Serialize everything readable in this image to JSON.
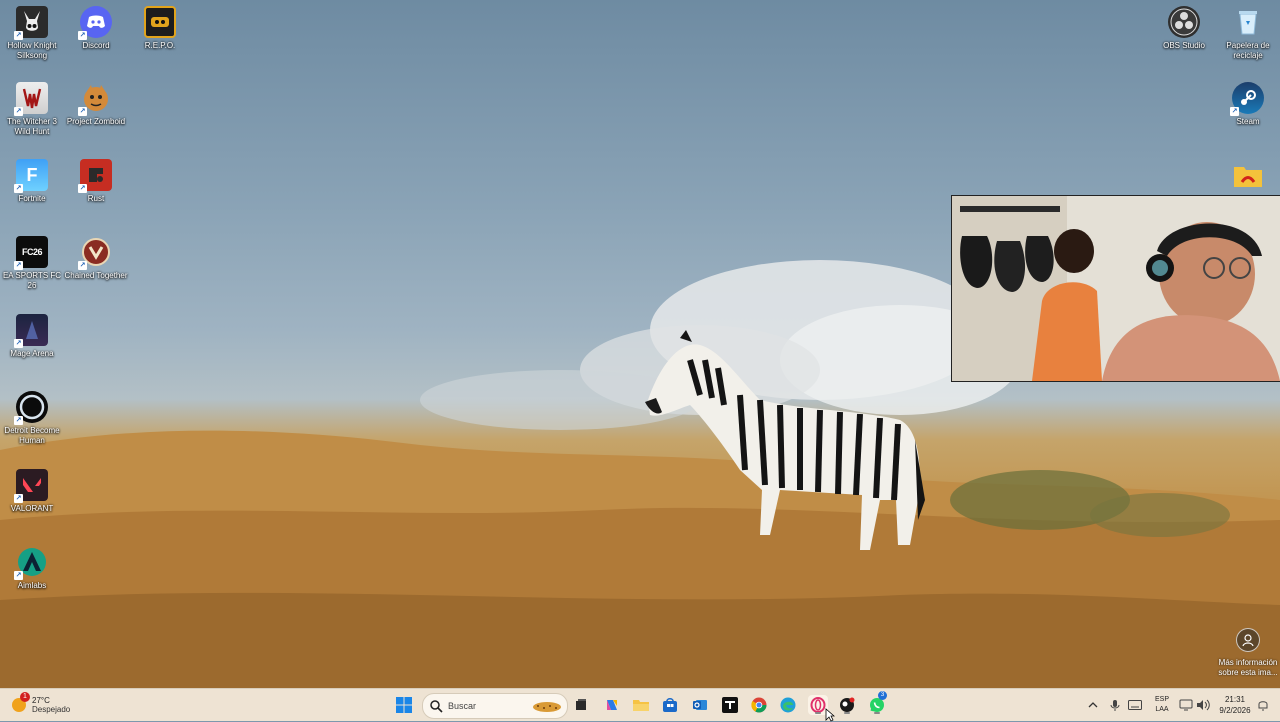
{
  "desktop": {
    "icons_left": [
      {
        "label": "Hollow Knight Silksong",
        "icon": "hollow-knight-icon"
      },
      {
        "label": "Discord",
        "icon": "discord-icon"
      },
      {
        "label": "R.E.P.O.",
        "icon": "repo-icon"
      },
      {
        "label": "The Witcher 3 Wild Hunt",
        "icon": "witcher-icon"
      },
      {
        "label": "Project Zomboid",
        "icon": "project-zomboid-icon"
      },
      {
        "label": "Fortnite",
        "icon": "fortnite-icon"
      },
      {
        "label": "Rust",
        "icon": "rust-icon"
      },
      {
        "label": "EA SPORTS FC 26",
        "icon": "ea-fc26-icon"
      },
      {
        "label": "Chained Together",
        "icon": "chained-together-icon"
      },
      {
        "label": "Mage Arena",
        "icon": "mage-arena-icon"
      },
      {
        "label": "Detroit Become Human",
        "icon": "detroit-icon"
      },
      {
        "label": "VALORANT",
        "icon": "valorant-icon"
      },
      {
        "label": "Aimlabs",
        "icon": "aimlabs-icon"
      }
    ],
    "icons_right": [
      {
        "label": "OBS Studio",
        "icon": "obs-icon"
      },
      {
        "label": "Papelera de reciclaje",
        "icon": "recycle-bin-icon"
      },
      {
        "label": "Steam",
        "icon": "steam-icon"
      },
      {
        "label": "",
        "icon": "folder-icon"
      }
    ],
    "learn_more": "Más información sobre esta ima..."
  },
  "taskbar": {
    "weather": {
      "temp": "27°C",
      "condition": "Despejado",
      "badge": "1",
      "icon": "sun-icon"
    },
    "search_placeholder": "Buscar",
    "apps": [
      {
        "name": "windows-start-icon"
      },
      {
        "name": "task-view-icon"
      },
      {
        "name": "copilot-icon"
      },
      {
        "name": "file-explorer-icon"
      },
      {
        "name": "microsoft-store-icon"
      },
      {
        "name": "outlook-icon"
      },
      {
        "name": "tidal-icon"
      },
      {
        "name": "chrome-icon"
      },
      {
        "name": "edge-icon"
      },
      {
        "name": "opera-gx-icon"
      },
      {
        "name": "game-app-icon"
      },
      {
        "name": "whatsapp-icon"
      }
    ],
    "whatsapp_badge": "3",
    "language": {
      "line1": "ESP",
      "line2": "LAA"
    },
    "clock": {
      "time": "21:31",
      "date": "9/2/2026"
    }
  },
  "colors": {
    "taskbar_bg": "#eee3d3",
    "accent": "#0a67d8"
  }
}
